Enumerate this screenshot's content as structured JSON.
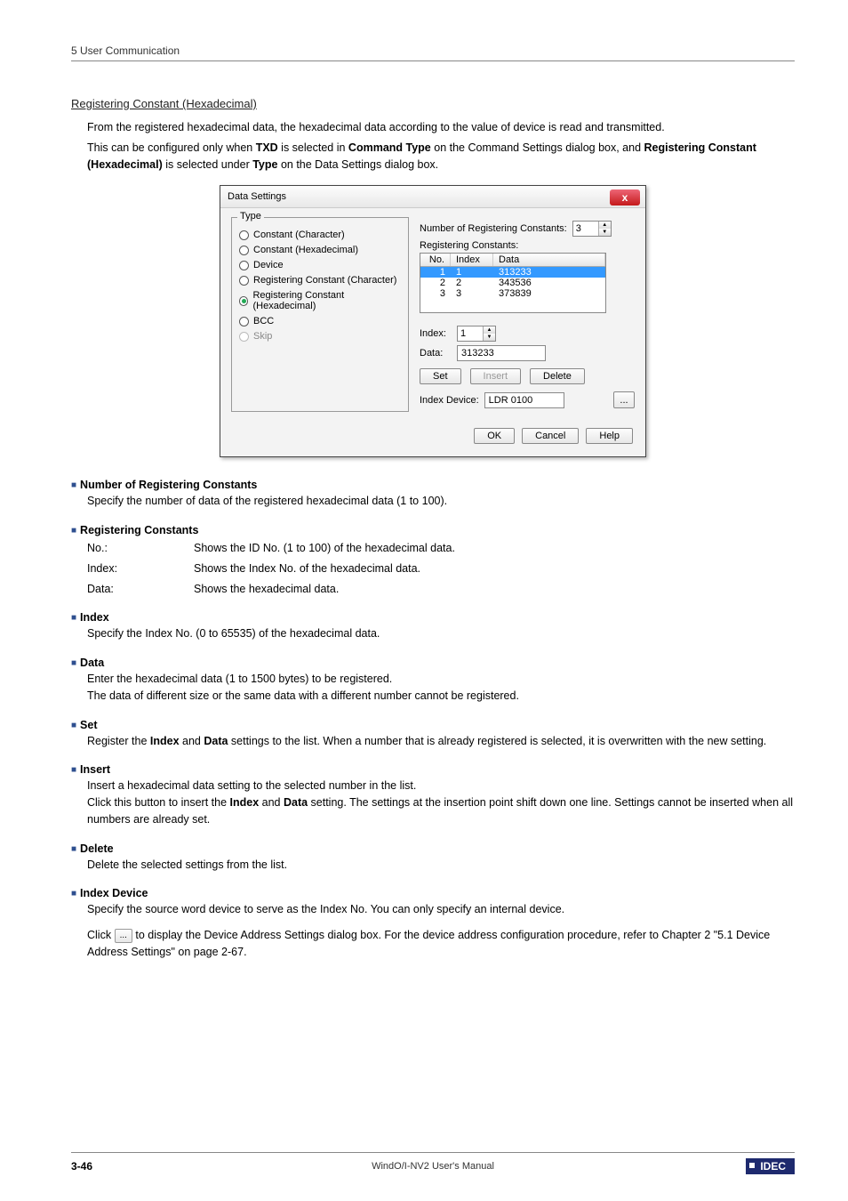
{
  "header": {
    "chapter": "5 User Communication"
  },
  "section": {
    "title": "Registering Constant (Hexadecimal)",
    "intro1": "From the registered hexadecimal data, the hexadecimal data according to the value of device is read and transmitted.",
    "intro2_pre": "This can be configured only when ",
    "intro2_bold1": "TXD",
    "intro2_mid1": " is selected in ",
    "intro2_bold2": "Command Type",
    "intro2_mid2": " on the Command Settings dialog box, and ",
    "intro2_bold3": "Registering Constant (Hexadecimal)",
    "intro2_mid3": " is selected under ",
    "intro2_bold4": "Type",
    "intro2_end": " on the Data Settings dialog box."
  },
  "dialog": {
    "title": "Data Settings",
    "close_x": "x",
    "type_legend": "Type",
    "types": {
      "const_char": "Constant (Character)",
      "const_hex": "Constant (Hexadecimal)",
      "device": "Device",
      "reg_const_char": "Registering Constant (Character)",
      "reg_const_hex": "Registering Constant (Hexadecimal)",
      "bcc": "BCC",
      "skip": "Skip"
    },
    "num_label": "Number of Registering Constants:",
    "num_value": "3",
    "regcon_label": "Registering Constants:",
    "col_no": "No.",
    "col_index": "Index",
    "col_data": "Data",
    "rows": [
      {
        "no": "1",
        "index": "1",
        "data": "313233"
      },
      {
        "no": "2",
        "index": "2",
        "data": "343536"
      },
      {
        "no": "3",
        "index": "3",
        "data": "373839"
      }
    ],
    "index_label": "Index:",
    "index_value": "1",
    "data_label": "Data:",
    "data_value": "313233",
    "set": "Set",
    "insert": "Insert",
    "delete": "Delete",
    "indexdev_label": "Index Device:",
    "indexdev_value": "LDR 0100",
    "browse": "...",
    "ok": "OK",
    "cancel": "Cancel",
    "help": "Help"
  },
  "desc": {
    "numrc": {
      "title": "Number of Registering Constants",
      "body": "Specify the number of data of the registered hexadecimal data (1 to 100)."
    },
    "rc": {
      "title": "Registering Constants",
      "no_k": "No.:",
      "no_v": "Shows the ID No. (1 to 100) of the hexadecimal data.",
      "idx_k": "Index:",
      "idx_v": "Shows the Index No. of the hexadecimal data.",
      "data_k": "Data:",
      "data_v": "Shows the hexadecimal data."
    },
    "index": {
      "title": "Index",
      "body": "Specify the Index No. (0 to 65535) of the hexadecimal data."
    },
    "data": {
      "title": "Data",
      "l1": "Enter the hexadecimal data (1 to 1500 bytes) to be registered.",
      "l2": "The data of different size or the same data with a different number cannot be registered."
    },
    "set": {
      "title": "Set",
      "pre": "Register the ",
      "b1": "Index",
      "mid1": " and ",
      "b2": "Data",
      "post": " settings to the list. When a number that is already registered is selected, it is overwritten with the new setting."
    },
    "insert": {
      "title": "Insert",
      "l1": "Insert a hexadecimal data setting to the selected number in the list.",
      "l2_pre": "Click this button to insert the ",
      "l2_b1": "Index",
      "l2_mid": " and ",
      "l2_b2": "Data",
      "l2_post": " setting. The settings at the insertion point shift down one line. Settings cannot be inserted when all numbers are already set."
    },
    "delete": {
      "title": "Delete",
      "body": "Delete the selected settings from the list."
    },
    "indexdev": {
      "title": "Index Device",
      "l1": "Specify the source word device to serve as the Index No. You can only specify an internal device.",
      "l2_pre": "Click ",
      "l2_btn": "...",
      "l2_post": " to display the Device Address Settings dialog box. For the device address configuration procedure, refer to Chapter 2 \"5.1 Device Address Settings\" on page 2-67."
    }
  },
  "footer": {
    "page": "3-46",
    "center": "WindO/I-NV2 User's Manual",
    "brand": "IDEC"
  }
}
